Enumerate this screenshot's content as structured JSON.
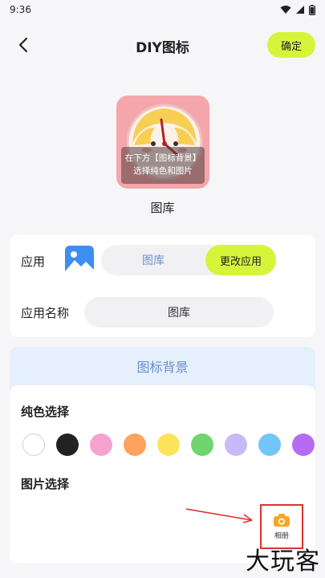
{
  "status": {
    "time": "9:36"
  },
  "header": {
    "title": "DIY图标",
    "confirm_label": "确定"
  },
  "preview": {
    "overlay_line1": "在下方【图标背景】",
    "overlay_line2": "选择纯色和图片",
    "app_name": "图库"
  },
  "app_settings": {
    "app_label": "应用",
    "current_app": "图库",
    "change_label": "更改应用",
    "name_label": "应用名称",
    "name_value": "图库"
  },
  "background": {
    "tab_label": "图标背景",
    "solid_label": "纯色选择",
    "image_label": "图片选择",
    "album_label": "相册",
    "colors": [
      "#ffffff",
      "#222222",
      "#f7a3cf",
      "#ffa25e",
      "#fbe45a",
      "#6fd56f",
      "#c8baf7",
      "#72c6f7",
      "#b56cf2"
    ]
  },
  "watermark": "大玩客"
}
